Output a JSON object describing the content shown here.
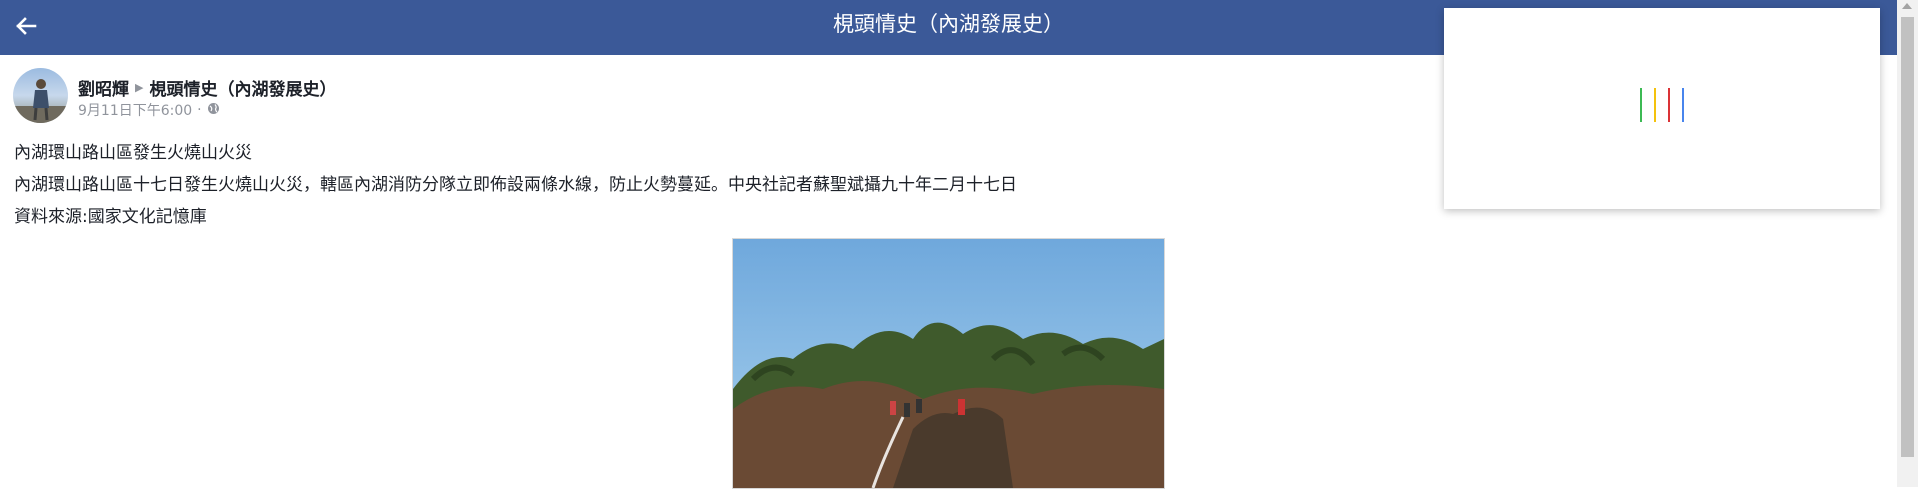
{
  "header": {
    "title": "梘頭情史（內湖發展史）",
    "back_icon": "back-arrow-icon"
  },
  "post": {
    "author": "劉昭輝",
    "group": "梘頭情史（內湖發展史）",
    "timestamp": "9月11日下午6:00",
    "separator": "·",
    "privacy_icon": "globe-icon",
    "lines": [
      "內湖環山路山區發生火燒山火災",
      "內湖環山路山區十七日發生火燒山火災，轄區內湖消防分隊立即佈設兩條水線，防止火勢蔓延。中央社記者蘇聖斌攝九十年二月十七日",
      "資料來源:國家文化記憶庫"
    ]
  },
  "popup": {
    "loader_colors": [
      "#3cba54",
      "#f4c20d",
      "#db3236",
      "#4885ed"
    ]
  },
  "colors": {
    "topbar": "#3b5998",
    "meta_text": "#90949c"
  }
}
